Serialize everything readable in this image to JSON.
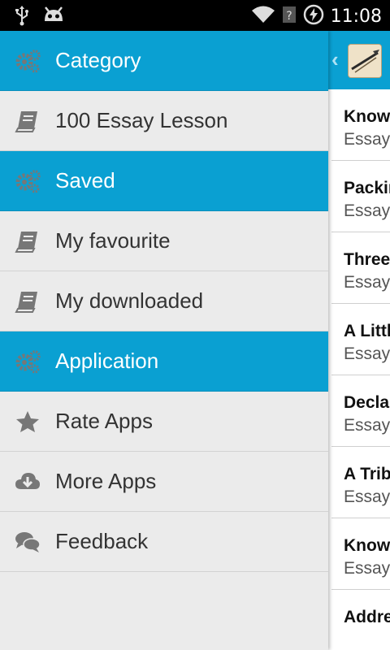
{
  "status_bar": {
    "time": "11:08",
    "icons": [
      "usb-icon",
      "android-debug-icon",
      "wifi-icon",
      "no-signal-icon",
      "data-saver-icon"
    ]
  },
  "drawer": {
    "sections": [
      {
        "type": "header",
        "label": "Category",
        "icon": "gears-icon"
      },
      {
        "type": "item",
        "label": "100 Essay Lesson",
        "icon": "book-icon"
      },
      {
        "type": "header",
        "label": "Saved",
        "icon": "gears-icon"
      },
      {
        "type": "item",
        "label": "My favourite",
        "icon": "book-icon"
      },
      {
        "type": "item",
        "label": "My downloaded",
        "icon": "book-icon"
      },
      {
        "type": "header",
        "label": "Application",
        "icon": "gears-icon"
      },
      {
        "type": "item",
        "label": "Rate Apps",
        "icon": "star-icon"
      },
      {
        "type": "item",
        "label": "More Apps",
        "icon": "cloud-download-icon"
      },
      {
        "type": "item",
        "label": "Feedback",
        "icon": "chat-icon"
      }
    ]
  },
  "main": {
    "header": {
      "up_icon": "chevron-left-icon",
      "logo_icon": "app-logo-icon"
    },
    "list": [
      {
        "title": "Knowle",
        "subtitle": "Essay"
      },
      {
        "title": "Packin",
        "subtitle": "Essay"
      },
      {
        "title": "Three",
        "subtitle": "Essay"
      },
      {
        "title": "A Little",
        "subtitle": "Essay"
      },
      {
        "title": "Declar",
        "subtitle": "Essay"
      },
      {
        "title": "A Tribu",
        "subtitle": "Essay"
      },
      {
        "title": "Knowle",
        "subtitle": "Essay"
      },
      {
        "title": "Addres",
        "subtitle": ""
      }
    ]
  },
  "colors": {
    "accent": "#0aa0d2",
    "drawer_bg": "#ebebeb",
    "icon_gray": "#707070"
  }
}
